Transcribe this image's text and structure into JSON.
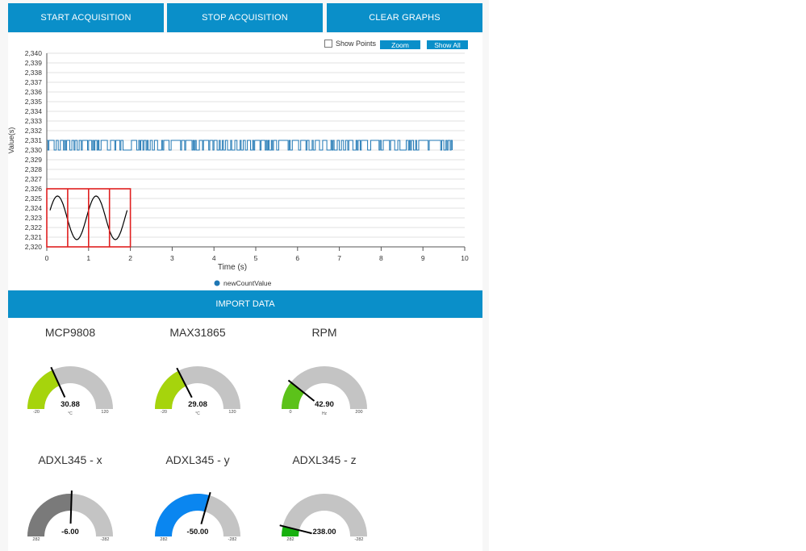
{
  "toolbar": {
    "start_label": "START ACQUISITION",
    "stop_label": "STOP ACQUISITION",
    "clear_label": "CLEAR GRAPHS"
  },
  "chart_controls": {
    "show_points_label": "Show Points",
    "show_points_checked": false,
    "zoom_label": "Zoom",
    "show_all_label": "Show All"
  },
  "chart_data": {
    "type": "line",
    "xlabel": "Time (s)",
    "ylabel": "Value(s)",
    "xlim": [
      0,
      10
    ],
    "ylim": [
      2320,
      2340
    ],
    "x_ticks": [
      0,
      1,
      2,
      3,
      4,
      5,
      6,
      7,
      8,
      9,
      10
    ],
    "y_ticks": [
      2320,
      2321,
      2322,
      2323,
      2324,
      2325,
      2326,
      2327,
      2328,
      2329,
      2330,
      2331,
      2332,
      2333,
      2334,
      2335,
      2336,
      2337,
      2338,
      2339,
      2340
    ],
    "y_tick_labels": [
      "2,320",
      "2,321",
      "2,322",
      "2,323",
      "2,324",
      "2,325",
      "2,326",
      "2,327",
      "2,328",
      "2,329",
      "2,330",
      "2,331",
      "2,332",
      "2,333",
      "2,334",
      "2,335",
      "2,336",
      "2,337",
      "2,338",
      "2,339",
      "2,340"
    ],
    "grid": true,
    "legend_position": "bottom",
    "series": [
      {
        "name": "newCountValue",
        "color": "#1f77b4",
        "x_range": [
          0,
          9.7
        ],
        "values_range": [
          2330,
          2331
        ]
      }
    ],
    "overview": {
      "wave_color": "#000000",
      "box_color": "#e02020",
      "x_range": [
        0,
        2
      ],
      "y_range": [
        2320,
        2326
      ]
    }
  },
  "import_label": "IMPORT DATA",
  "gauges": [
    {
      "title": "MCP9808",
      "value": "30.88",
      "numeric": 30.88,
      "unit": "°C",
      "min": "-20",
      "max": "120",
      "min_val": -20,
      "max_val": 120,
      "color": "#a6d40c"
    },
    {
      "title": "MAX31865",
      "value": "29.08",
      "numeric": 29.08,
      "unit": "°C",
      "min": "-20",
      "max": "120",
      "min_val": -20,
      "max_val": 120,
      "color": "#a6d40c"
    },
    {
      "title": "RPM",
      "value": "42.90",
      "numeric": 42.9,
      "unit": "Hz",
      "min": "0",
      "max": "200",
      "min_val": 0,
      "max_val": 200,
      "color": "#5cc21a"
    },
    {
      "title": "ADXL345 - x",
      "value": "-6.00",
      "numeric": -6,
      "unit": "",
      "min": "282",
      "max": "-282",
      "min_val": 282,
      "max_val": -282,
      "color": "#7a7a7a"
    },
    {
      "title": "ADXL345 - y",
      "value": "-50.00",
      "numeric": -50,
      "unit": "",
      "min": "282",
      "max": "-282",
      "min_val": 282,
      "max_val": -282,
      "color": "#0a86f0"
    },
    {
      "title": "ADXL345 - z",
      "value": "238.00",
      "numeric": 238,
      "unit": "",
      "min": "282",
      "max": "-282",
      "min_val": 282,
      "max_val": -282,
      "color": "#17b00f"
    }
  ]
}
